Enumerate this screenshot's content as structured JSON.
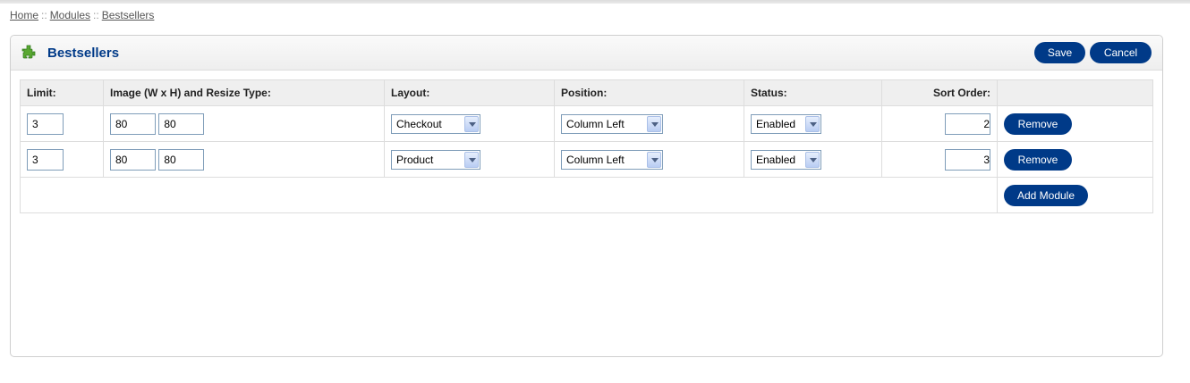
{
  "breadcrumb": {
    "home": "Home",
    "sep": "::",
    "modules": "Modules",
    "current": "Bestsellers"
  },
  "heading": {
    "title": "Bestsellers",
    "icon": "puzzle-icon"
  },
  "actions": {
    "save": "Save",
    "cancel": "Cancel"
  },
  "columns": {
    "limit": "Limit:",
    "image": "Image (W x H) and Resize Type:",
    "layout": "Layout:",
    "position": "Position:",
    "status": "Status:",
    "sort_order": "Sort Order:"
  },
  "rows": [
    {
      "limit": "3",
      "width": "80",
      "height": "80",
      "layout": "Checkout",
      "position": "Column Left",
      "status": "Enabled",
      "sort_order": "2",
      "remove": "Remove"
    },
    {
      "limit": "3",
      "width": "80",
      "height": "80",
      "layout": "Product",
      "position": "Column Left",
      "status": "Enabled",
      "sort_order": "3",
      "remove": "Remove"
    }
  ],
  "add_module": "Add Module",
  "colors": {
    "accent": "#003a88",
    "heading_text": "#003a88"
  }
}
